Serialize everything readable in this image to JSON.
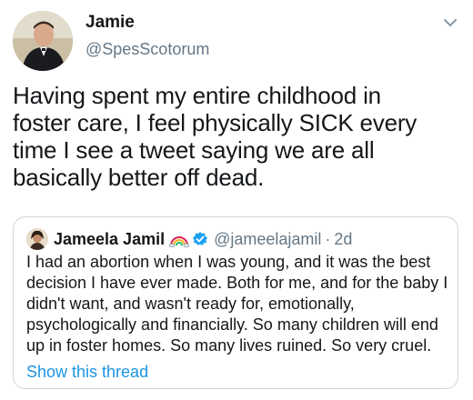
{
  "tweet": {
    "display_name": "Jamie",
    "handle": "@SpesScotorum",
    "text": "Having spent my entire childhood in\nfoster care, I feel physically SICK every\ntime I see a tweet saying we are all\nbasically better off dead."
  },
  "quoted_tweet": {
    "display_name": "Jameela Jamil",
    "name_emoji_icon": "rainbow-icon",
    "verified_icon": "verified-badge-icon",
    "handle": "@jameelajamil",
    "separator": "·",
    "time": "2d",
    "text": "I had an abortion when I was young, and it was the best\ndecision I have ever made. Both for me, and for the baby I\ndidn't want, and wasn't ready for, emotionally,\npsychologically and financially. So many children will end\nup in foster homes. So many lives ruined. So very cruel.",
    "show_thread": "Show this thread"
  },
  "colors": {
    "primary_text": "#14171a",
    "secondary_text": "#657786",
    "link": "#1b95e0",
    "verified": "#1da1f2",
    "border": "#ccd6dd"
  }
}
